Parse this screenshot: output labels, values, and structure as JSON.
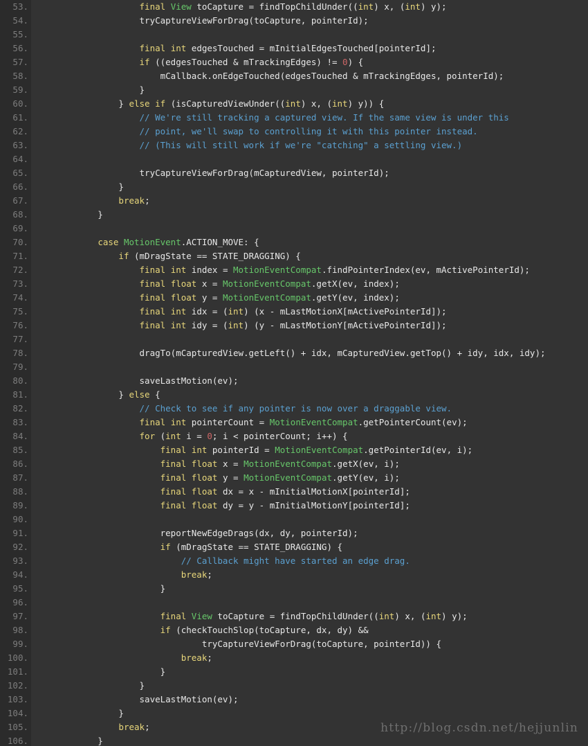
{
  "editor": {
    "language": "java",
    "theme_name": "dark",
    "first_line_number": 53,
    "last_line_number": 106,
    "line_number_suffix": ".",
    "colors": {
      "background": "#333333",
      "gutter_background": "#2b2b2b",
      "line_number": "#7d7d7d",
      "default_text": "#e8e8e8",
      "keyword": "#e8d77b",
      "type": "#67c76a",
      "class_name": "#67c76a",
      "comment": "#5ba0d0",
      "number_literal": "#cc6666",
      "watermark": "#6f6f6f"
    }
  },
  "watermark": {
    "text": "http://blog.csdn.net/hejjunlin"
  },
  "lines": [
    {
      "n": "53.",
      "tokens": [
        {
          "t": "txt",
          "s": "                    "
        },
        {
          "t": "kw",
          "s": "final"
        },
        {
          "t": "txt",
          "s": " "
        },
        {
          "t": "typ",
          "s": "View"
        },
        {
          "t": "txt",
          "s": " toCapture = findTopChildUnder(("
        },
        {
          "t": "kw",
          "s": "int"
        },
        {
          "t": "txt",
          "s": ") x, ("
        },
        {
          "t": "kw",
          "s": "int"
        },
        {
          "t": "txt",
          "s": ") y);"
        }
      ]
    },
    {
      "n": "54.",
      "tokens": [
        {
          "t": "txt",
          "s": "                    tryCaptureViewForDrag(toCapture, pointerId);"
        }
      ]
    },
    {
      "n": "55.",
      "tokens": [
        {
          "t": "txt",
          "s": ""
        }
      ]
    },
    {
      "n": "56.",
      "tokens": [
        {
          "t": "txt",
          "s": "                    "
        },
        {
          "t": "kw",
          "s": "final"
        },
        {
          "t": "txt",
          "s": " "
        },
        {
          "t": "kw",
          "s": "int"
        },
        {
          "t": "txt",
          "s": " edgesTouched = mInitialEdgesTouched[pointerId];"
        }
      ]
    },
    {
      "n": "57.",
      "tokens": [
        {
          "t": "txt",
          "s": "                    "
        },
        {
          "t": "kw",
          "s": "if"
        },
        {
          "t": "txt",
          "s": " ((edgesTouched & mTrackingEdges) != "
        },
        {
          "t": "num",
          "s": "0"
        },
        {
          "t": "txt",
          "s": ") {"
        }
      ]
    },
    {
      "n": "58.",
      "tokens": [
        {
          "t": "txt",
          "s": "                        mCallback.onEdgeTouched(edgesTouched & mTrackingEdges, pointerId);"
        }
      ]
    },
    {
      "n": "59.",
      "tokens": [
        {
          "t": "txt",
          "s": "                    }"
        }
      ]
    },
    {
      "n": "60.",
      "tokens": [
        {
          "t": "txt",
          "s": "                } "
        },
        {
          "t": "kw",
          "s": "else"
        },
        {
          "t": "txt",
          "s": " "
        },
        {
          "t": "kw",
          "s": "if"
        },
        {
          "t": "txt",
          "s": " (isCapturedViewUnder(("
        },
        {
          "t": "kw",
          "s": "int"
        },
        {
          "t": "txt",
          "s": ") x, ("
        },
        {
          "t": "kw",
          "s": "int"
        },
        {
          "t": "txt",
          "s": ") y)) {"
        }
      ]
    },
    {
      "n": "61.",
      "tokens": [
        {
          "t": "txt",
          "s": "                    "
        },
        {
          "t": "com",
          "s": "// We're still tracking a captured view. If the same view is under this"
        }
      ]
    },
    {
      "n": "62.",
      "tokens": [
        {
          "t": "txt",
          "s": "                    "
        },
        {
          "t": "com",
          "s": "// point, we'll swap to controlling it with this pointer instead."
        }
      ]
    },
    {
      "n": "63.",
      "tokens": [
        {
          "t": "txt",
          "s": "                    "
        },
        {
          "t": "com",
          "s": "// (This will still work if we're \"catching\" a settling view.)"
        }
      ]
    },
    {
      "n": "64.",
      "tokens": [
        {
          "t": "txt",
          "s": ""
        }
      ]
    },
    {
      "n": "65.",
      "tokens": [
        {
          "t": "txt",
          "s": "                    tryCaptureViewForDrag(mCapturedView, pointerId);"
        }
      ]
    },
    {
      "n": "66.",
      "tokens": [
        {
          "t": "txt",
          "s": "                }"
        }
      ]
    },
    {
      "n": "67.",
      "tokens": [
        {
          "t": "txt",
          "s": "                "
        },
        {
          "t": "kw",
          "s": "break"
        },
        {
          "t": "txt",
          "s": ";"
        }
      ]
    },
    {
      "n": "68.",
      "tokens": [
        {
          "t": "txt",
          "s": "            }"
        }
      ]
    },
    {
      "n": "69.",
      "tokens": [
        {
          "t": "txt",
          "s": ""
        }
      ]
    },
    {
      "n": "70.",
      "tokens": [
        {
          "t": "txt",
          "s": "            "
        },
        {
          "t": "kw",
          "s": "case"
        },
        {
          "t": "txt",
          "s": " "
        },
        {
          "t": "cls",
          "s": "MotionEvent"
        },
        {
          "t": "txt",
          "s": ".ACTION_MOVE: {"
        }
      ]
    },
    {
      "n": "71.",
      "tokens": [
        {
          "t": "txt",
          "s": "                "
        },
        {
          "t": "kw",
          "s": "if"
        },
        {
          "t": "txt",
          "s": " (mDragState == STATE_DRAGGING) {"
        }
      ]
    },
    {
      "n": "72.",
      "tokens": [
        {
          "t": "txt",
          "s": "                    "
        },
        {
          "t": "kw",
          "s": "final"
        },
        {
          "t": "txt",
          "s": " "
        },
        {
          "t": "kw",
          "s": "int"
        },
        {
          "t": "txt",
          "s": " index = "
        },
        {
          "t": "cls",
          "s": "MotionEventCompat"
        },
        {
          "t": "txt",
          "s": ".findPointerIndex(ev, mActivePointerId);"
        }
      ]
    },
    {
      "n": "73.",
      "tokens": [
        {
          "t": "txt",
          "s": "                    "
        },
        {
          "t": "kw",
          "s": "final"
        },
        {
          "t": "txt",
          "s": " "
        },
        {
          "t": "kw",
          "s": "float"
        },
        {
          "t": "txt",
          "s": " x = "
        },
        {
          "t": "cls",
          "s": "MotionEventCompat"
        },
        {
          "t": "txt",
          "s": ".getX(ev, index);"
        }
      ]
    },
    {
      "n": "74.",
      "tokens": [
        {
          "t": "txt",
          "s": "                    "
        },
        {
          "t": "kw",
          "s": "final"
        },
        {
          "t": "txt",
          "s": " "
        },
        {
          "t": "kw",
          "s": "float"
        },
        {
          "t": "txt",
          "s": " y = "
        },
        {
          "t": "cls",
          "s": "MotionEventCompat"
        },
        {
          "t": "txt",
          "s": ".getY(ev, index);"
        }
      ]
    },
    {
      "n": "75.",
      "tokens": [
        {
          "t": "txt",
          "s": "                    "
        },
        {
          "t": "kw",
          "s": "final"
        },
        {
          "t": "txt",
          "s": " "
        },
        {
          "t": "kw",
          "s": "int"
        },
        {
          "t": "txt",
          "s": " idx = ("
        },
        {
          "t": "kw",
          "s": "int"
        },
        {
          "t": "txt",
          "s": ") (x - mLastMotionX[mActivePointerId]);"
        }
      ]
    },
    {
      "n": "76.",
      "tokens": [
        {
          "t": "txt",
          "s": "                    "
        },
        {
          "t": "kw",
          "s": "final"
        },
        {
          "t": "txt",
          "s": " "
        },
        {
          "t": "kw",
          "s": "int"
        },
        {
          "t": "txt",
          "s": " idy = ("
        },
        {
          "t": "kw",
          "s": "int"
        },
        {
          "t": "txt",
          "s": ") (y - mLastMotionY[mActivePointerId]);"
        }
      ]
    },
    {
      "n": "77.",
      "tokens": [
        {
          "t": "txt",
          "s": ""
        }
      ]
    },
    {
      "n": "78.",
      "tokens": [
        {
          "t": "txt",
          "s": "                    dragTo(mCapturedView.getLeft() + idx, mCapturedView.getTop() + idy, idx, idy);"
        }
      ]
    },
    {
      "n": "79.",
      "tokens": [
        {
          "t": "txt",
          "s": ""
        }
      ]
    },
    {
      "n": "80.",
      "tokens": [
        {
          "t": "txt",
          "s": "                    saveLastMotion(ev);"
        }
      ]
    },
    {
      "n": "81.",
      "tokens": [
        {
          "t": "txt",
          "s": "                } "
        },
        {
          "t": "kw",
          "s": "else"
        },
        {
          "t": "txt",
          "s": " {"
        }
      ]
    },
    {
      "n": "82.",
      "tokens": [
        {
          "t": "txt",
          "s": "                    "
        },
        {
          "t": "com",
          "s": "// Check to see if any pointer is now over a draggable view."
        }
      ]
    },
    {
      "n": "83.",
      "tokens": [
        {
          "t": "txt",
          "s": "                    "
        },
        {
          "t": "kw",
          "s": "final"
        },
        {
          "t": "txt",
          "s": " "
        },
        {
          "t": "kw",
          "s": "int"
        },
        {
          "t": "txt",
          "s": " pointerCount = "
        },
        {
          "t": "cls",
          "s": "MotionEventCompat"
        },
        {
          "t": "txt",
          "s": ".getPointerCount(ev);"
        }
      ]
    },
    {
      "n": "84.",
      "tokens": [
        {
          "t": "txt",
          "s": "                    "
        },
        {
          "t": "kw",
          "s": "for"
        },
        {
          "t": "txt",
          "s": " ("
        },
        {
          "t": "kw",
          "s": "int"
        },
        {
          "t": "txt",
          "s": " i = "
        },
        {
          "t": "num",
          "s": "0"
        },
        {
          "t": "txt",
          "s": "; i < pointerCount; i++) {"
        }
      ]
    },
    {
      "n": "85.",
      "tokens": [
        {
          "t": "txt",
          "s": "                        "
        },
        {
          "t": "kw",
          "s": "final"
        },
        {
          "t": "txt",
          "s": " "
        },
        {
          "t": "kw",
          "s": "int"
        },
        {
          "t": "txt",
          "s": " pointerId = "
        },
        {
          "t": "cls",
          "s": "MotionEventCompat"
        },
        {
          "t": "txt",
          "s": ".getPointerId(ev, i);"
        }
      ]
    },
    {
      "n": "86.",
      "tokens": [
        {
          "t": "txt",
          "s": "                        "
        },
        {
          "t": "kw",
          "s": "final"
        },
        {
          "t": "txt",
          "s": " "
        },
        {
          "t": "kw",
          "s": "float"
        },
        {
          "t": "txt",
          "s": " x = "
        },
        {
          "t": "cls",
          "s": "MotionEventCompat"
        },
        {
          "t": "txt",
          "s": ".getX(ev, i);"
        }
      ]
    },
    {
      "n": "87.",
      "tokens": [
        {
          "t": "txt",
          "s": "                        "
        },
        {
          "t": "kw",
          "s": "final"
        },
        {
          "t": "txt",
          "s": " "
        },
        {
          "t": "kw",
          "s": "float"
        },
        {
          "t": "txt",
          "s": " y = "
        },
        {
          "t": "cls",
          "s": "MotionEventCompat"
        },
        {
          "t": "txt",
          "s": ".getY(ev, i);"
        }
      ]
    },
    {
      "n": "88.",
      "tokens": [
        {
          "t": "txt",
          "s": "                        "
        },
        {
          "t": "kw",
          "s": "final"
        },
        {
          "t": "txt",
          "s": " "
        },
        {
          "t": "kw",
          "s": "float"
        },
        {
          "t": "txt",
          "s": " dx = x - mInitialMotionX[pointerId];"
        }
      ]
    },
    {
      "n": "89.",
      "tokens": [
        {
          "t": "txt",
          "s": "                        "
        },
        {
          "t": "kw",
          "s": "final"
        },
        {
          "t": "txt",
          "s": " "
        },
        {
          "t": "kw",
          "s": "float"
        },
        {
          "t": "txt",
          "s": " dy = y - mInitialMotionY[pointerId];"
        }
      ]
    },
    {
      "n": "90.",
      "tokens": [
        {
          "t": "txt",
          "s": ""
        }
      ]
    },
    {
      "n": "91.",
      "tokens": [
        {
          "t": "txt",
          "s": "                        reportNewEdgeDrags(dx, dy, pointerId);"
        }
      ]
    },
    {
      "n": "92.",
      "tokens": [
        {
          "t": "txt",
          "s": "                        "
        },
        {
          "t": "kw",
          "s": "if"
        },
        {
          "t": "txt",
          "s": " (mDragState == STATE_DRAGGING) {"
        }
      ]
    },
    {
      "n": "93.",
      "tokens": [
        {
          "t": "txt",
          "s": "                            "
        },
        {
          "t": "com",
          "s": "// Callback might have started an edge drag."
        }
      ]
    },
    {
      "n": "94.",
      "tokens": [
        {
          "t": "txt",
          "s": "                            "
        },
        {
          "t": "kw",
          "s": "break"
        },
        {
          "t": "txt",
          "s": ";"
        }
      ]
    },
    {
      "n": "95.",
      "tokens": [
        {
          "t": "txt",
          "s": "                        }"
        }
      ]
    },
    {
      "n": "96.",
      "tokens": [
        {
          "t": "txt",
          "s": ""
        }
      ]
    },
    {
      "n": "97.",
      "tokens": [
        {
          "t": "txt",
          "s": "                        "
        },
        {
          "t": "kw",
          "s": "final"
        },
        {
          "t": "txt",
          "s": " "
        },
        {
          "t": "typ",
          "s": "View"
        },
        {
          "t": "txt",
          "s": " toCapture = findTopChildUnder(("
        },
        {
          "t": "kw",
          "s": "int"
        },
        {
          "t": "txt",
          "s": ") x, ("
        },
        {
          "t": "kw",
          "s": "int"
        },
        {
          "t": "txt",
          "s": ") y);"
        }
      ]
    },
    {
      "n": "98.",
      "tokens": [
        {
          "t": "txt",
          "s": "                        "
        },
        {
          "t": "kw",
          "s": "if"
        },
        {
          "t": "txt",
          "s": " (checkTouchSlop(toCapture, dx, dy) &&"
        }
      ]
    },
    {
      "n": "99.",
      "tokens": [
        {
          "t": "txt",
          "s": "                                tryCaptureViewForDrag(toCapture, pointerId)) {"
        }
      ]
    },
    {
      "n": "100.",
      "tokens": [
        {
          "t": "txt",
          "s": "                            "
        },
        {
          "t": "kw",
          "s": "break"
        },
        {
          "t": "txt",
          "s": ";"
        }
      ]
    },
    {
      "n": "101.",
      "tokens": [
        {
          "t": "txt",
          "s": "                        }"
        }
      ]
    },
    {
      "n": "102.",
      "tokens": [
        {
          "t": "txt",
          "s": "                    }"
        }
      ]
    },
    {
      "n": "103.",
      "tokens": [
        {
          "t": "txt",
          "s": "                    saveLastMotion(ev);"
        }
      ]
    },
    {
      "n": "104.",
      "tokens": [
        {
          "t": "txt",
          "s": "                }"
        }
      ]
    },
    {
      "n": "105.",
      "tokens": [
        {
          "t": "txt",
          "s": "                "
        },
        {
          "t": "kw",
          "s": "break"
        },
        {
          "t": "txt",
          "s": ";"
        }
      ]
    },
    {
      "n": "106.",
      "tokens": [
        {
          "t": "txt",
          "s": "            }"
        }
      ]
    }
  ]
}
